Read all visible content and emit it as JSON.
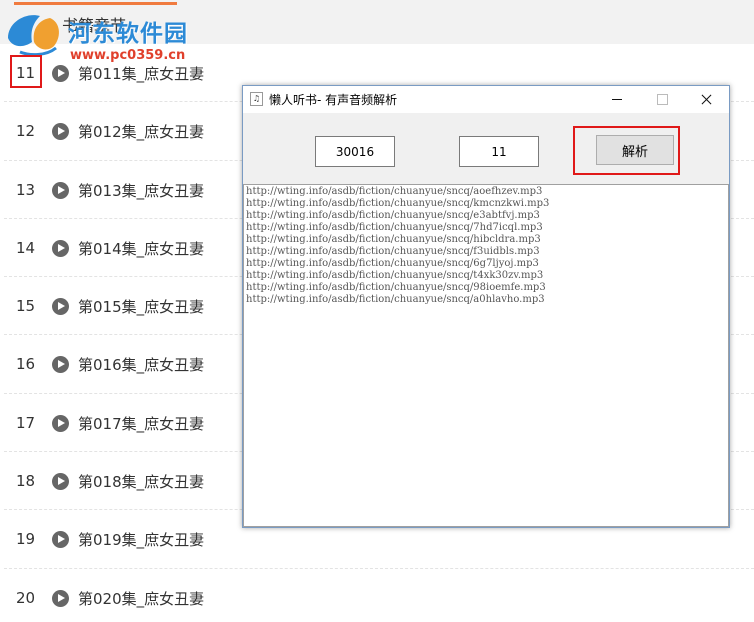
{
  "page": {
    "tab_title": "书籍章节",
    "watermark": {
      "name": "河东软件园",
      "url": "www.pc0359.cn"
    }
  },
  "chapters": [
    {
      "num": "11",
      "title": "第011集_庶女丑妻"
    },
    {
      "num": "12",
      "title": "第012集_庶女丑妻"
    },
    {
      "num": "13",
      "title": "第013集_庶女丑妻"
    },
    {
      "num": "14",
      "title": "第014集_庶女丑妻"
    },
    {
      "num": "15",
      "title": "第015集_庶女丑妻"
    },
    {
      "num": "16",
      "title": "第016集_庶女丑妻"
    },
    {
      "num": "17",
      "title": "第017集_庶女丑妻"
    },
    {
      "num": "18",
      "title": "第018集_庶女丑妻"
    },
    {
      "num": "19",
      "title": "第019集_庶女丑妻"
    },
    {
      "num": "20",
      "title": "第020集_庶女丑妻"
    }
  ],
  "dialog": {
    "title": "懒人听书- 有声音频解析",
    "icon_glyph": "♫",
    "field_a": "30016",
    "field_b": "11",
    "parse_label": "解析",
    "urls": [
      "http://wting.info/asdb/fiction/chuanyue/sncq/aoefhzev.mp3",
      "http://wting.info/asdb/fiction/chuanyue/sncq/kmcnzkwi.mp3",
      "http://wting.info/asdb/fiction/chuanyue/sncq/e3abtfvj.mp3",
      "http://wting.info/asdb/fiction/chuanyue/sncq/7hd7icql.mp3",
      "http://wting.info/asdb/fiction/chuanyue/sncq/hibcldra.mp3",
      "http://wting.info/asdb/fiction/chuanyue/sncq/f3uidbls.mp3",
      "http://wting.info/asdb/fiction/chuanyue/sncq/6g7ljyoj.mp3",
      "http://wting.info/asdb/fiction/chuanyue/sncq/t4xk30zv.mp3",
      "http://wting.info/asdb/fiction/chuanyue/sncq/98ioemfe.mp3",
      "http://wting.info/asdb/fiction/chuanyue/sncq/a0hlavho.mp3"
    ]
  },
  "colors": {
    "accent_tab": "#f07b3f",
    "highlight": "#e01919",
    "watermark_blue": "#2c8ad6",
    "watermark_red": "#e0402c"
  }
}
